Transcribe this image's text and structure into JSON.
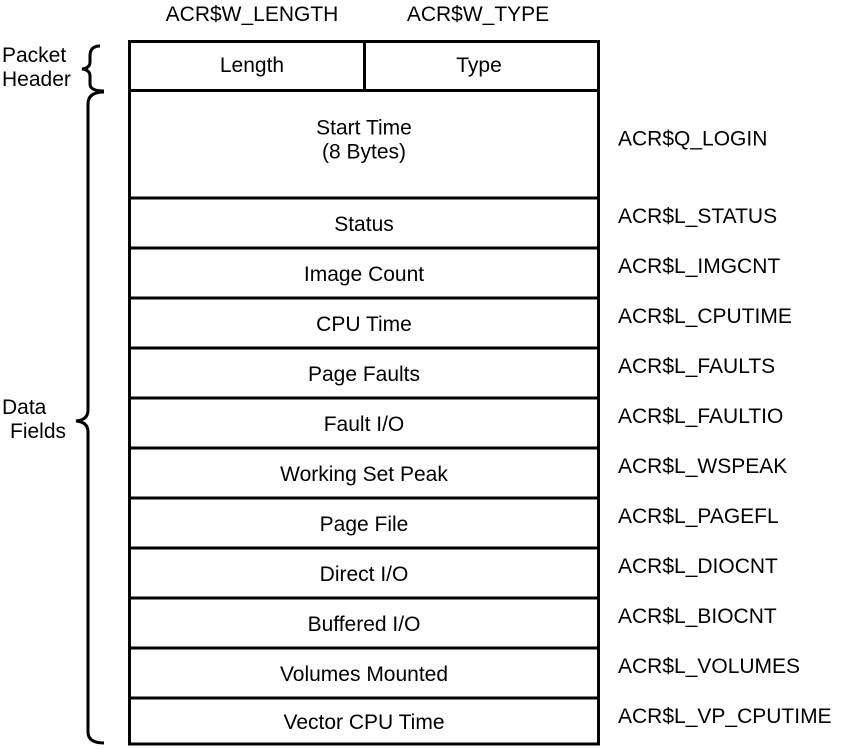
{
  "header": {
    "left_symbol": "ACR$W_LENGTH",
    "right_symbol": "ACR$W_TYPE",
    "fields": [
      "Length",
      "Type"
    ]
  },
  "groups": {
    "packet_header": [
      "Packet",
      "Header"
    ],
    "data_fields": [
      "Data",
      "Fields"
    ]
  },
  "rows": [
    {
      "label": "Start Time",
      "sub": "(8 Bytes)",
      "symbol": "ACR$Q_LOGIN"
    },
    {
      "label": "Status",
      "symbol": "ACR$L_STATUS"
    },
    {
      "label": "Image Count",
      "symbol": "ACR$L_IMGCNT"
    },
    {
      "label": "CPU Time",
      "symbol": "ACR$L_CPUTIME"
    },
    {
      "label": "Page Faults",
      "symbol": "ACR$L_FAULTS"
    },
    {
      "label": "Fault I/O",
      "symbol": "ACR$L_FAULTIO"
    },
    {
      "label": "Working Set Peak",
      "symbol": "ACR$L_WSPEAK"
    },
    {
      "label": "Page File",
      "symbol": "ACR$L_PAGEFL"
    },
    {
      "label": "Direct I/O",
      "symbol": "ACR$L_DIOCNT"
    },
    {
      "label": "Buffered I/O",
      "symbol": "ACR$L_BIOCNT"
    },
    {
      "label": "Volumes Mounted",
      "symbol": "ACR$L_VOLUMES"
    },
    {
      "label": "Vector CPU Time",
      "symbol": "ACR$L_VP_CPUTIME"
    }
  ]
}
